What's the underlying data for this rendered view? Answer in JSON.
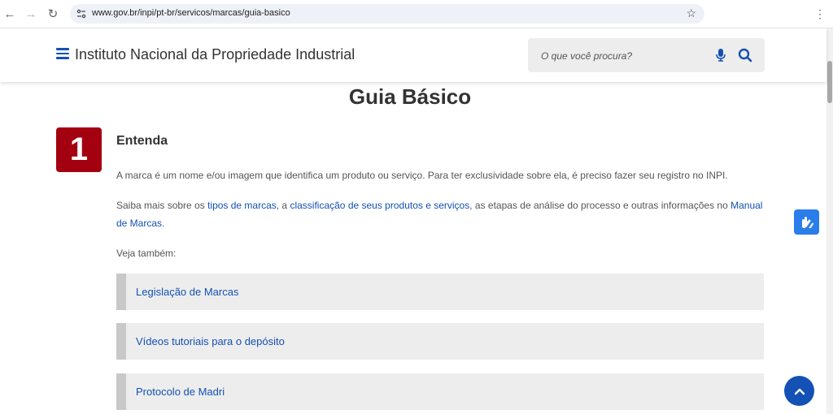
{
  "browser": {
    "url": "www.gov.br/inpi/pt-br/servicos/marcas/guia-basico",
    "back_icon": "←",
    "forward_icon": "→",
    "reload_icon": "↻",
    "star_icon": "☆",
    "menu_icon": "⋮"
  },
  "header": {
    "title": "Instituto Nacional da Propriedade Industrial",
    "search_placeholder": "O que você procura?"
  },
  "main": {
    "page_title": "Guia Básico",
    "step_number": "1",
    "step_heading": "Entenda",
    "paragraph1": "A marca é um nome e/ou imagem que identifica um produto ou serviço. Para ter exclusividade sobre ela, é preciso fazer seu registro no INPI.",
    "paragraph2": {
      "t1": "Saiba mais sobre os ",
      "link1": "tipos de marcas",
      "t2": ", a ",
      "link2": "classificação de seus produtos e serviços",
      "t3": ", as etapas de análise do processo e outras informações no ",
      "link3": "Manual de Marcas",
      "t4": "."
    },
    "see_also": "Veja também:",
    "accordions": [
      {
        "label": "Legislação de Marcas"
      },
      {
        "label": "Vídeos tutoriais para o depósito"
      },
      {
        "label": "Protocolo de Madri"
      }
    ]
  },
  "colors": {
    "brand_blue": "#1351b4",
    "step_red": "#a3010f",
    "accessibility_blue": "#2b7de9"
  }
}
